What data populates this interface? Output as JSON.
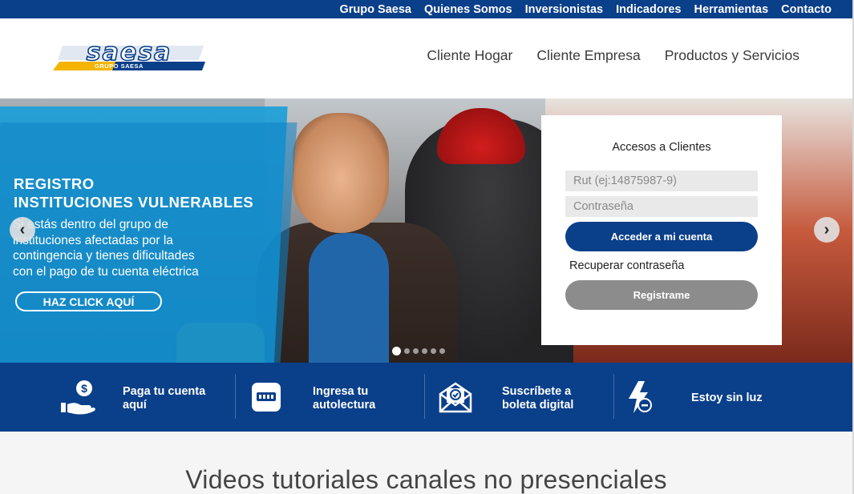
{
  "topbar": {
    "links": [
      "Grupo Saesa",
      "Quienes Somos",
      "Inversionistas",
      "Indicadores",
      "Herramientas",
      "Contacto"
    ]
  },
  "header": {
    "logo_text": "saesa",
    "logo_subtext": "GRUPO SAESA",
    "nav": [
      "Cliente Hogar",
      "Cliente Empresa",
      "Productos y Servicios"
    ]
  },
  "hero": {
    "promo_title": "REGISTRO\nINSTITUCIONES VULNERABLES",
    "promo_text": "Si estás dentro del grupo de\ninstituciones afectadas por la\ncontingencia y tienes dificultades\ncon el pago de tu cuenta eléctrica",
    "promo_button": "HAZ CLICK AQUÍ",
    "prev_arrow": "‹",
    "next_arrow": "›",
    "slide_count": 6,
    "active_slide": 1
  },
  "login": {
    "title": "Accesos a Clientes",
    "rut_placeholder": "Rut (ej:14875987-9)",
    "password_placeholder": "Contraseña",
    "submit_label": "Acceder a mi cuenta",
    "recover_label": "Recuperar contraseña",
    "register_label": "Registrame"
  },
  "quick_links": [
    {
      "label": "Paga tu cuenta\naquí",
      "icon": "pay-hand-icon"
    },
    {
      "label": "Ingresa tu\nautolectura",
      "icon": "meter-icon"
    },
    {
      "label": "Suscríbete a\nboleta digital",
      "icon": "envelope-check-icon"
    },
    {
      "label": "Estoy sin luz",
      "icon": "power-outage-icon"
    }
  ],
  "section": {
    "title": "Videos tutoriales canales no presenciales"
  },
  "colors": {
    "brand_blue": "#0a3f8a",
    "promo_cyan": "#159dd8",
    "logo_yellow": "#f5b400"
  }
}
